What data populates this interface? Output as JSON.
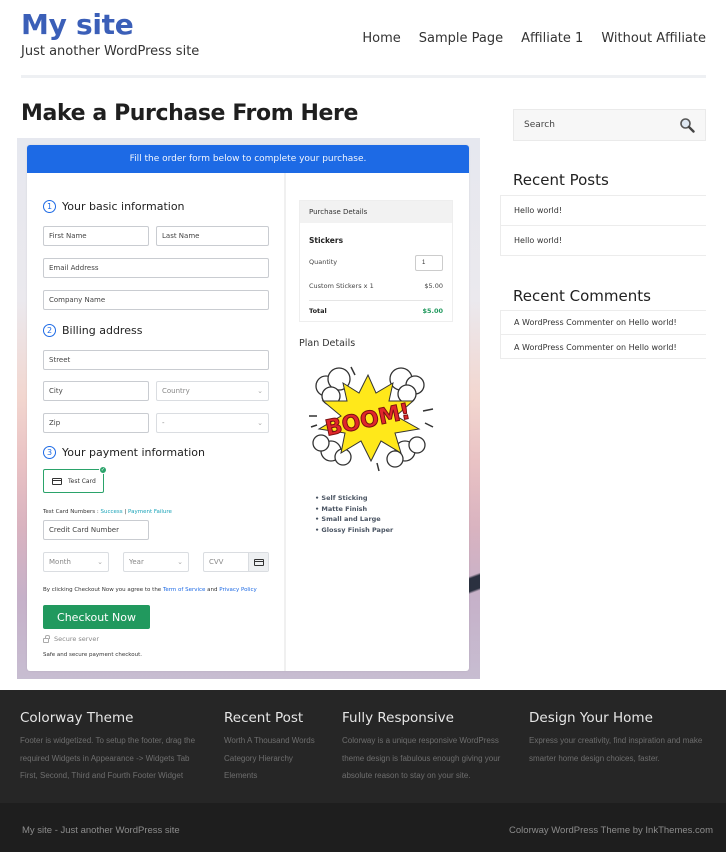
{
  "header": {
    "site_title": "My site",
    "tagline": "Just another WordPress site",
    "nav": [
      {
        "label": "Home"
      },
      {
        "label": "Sample Page"
      },
      {
        "label": "Affiliate 1"
      },
      {
        "label": "Without Affiliate"
      }
    ]
  },
  "main": {
    "page_title": "Make a Purchase From Here",
    "order_form": {
      "banner": "Fill the order form below to complete your purchase.",
      "sections": [
        {
          "number": "1",
          "title": "Your basic information"
        },
        {
          "number": "2",
          "title": "Billing address"
        },
        {
          "number": "3",
          "title": "Your payment information"
        }
      ],
      "fields": {
        "first_name": "First Name",
        "last_name": "Last Name",
        "email": "Email Address",
        "company": "Company Name",
        "street": "Street",
        "city": "City",
        "country": "Country",
        "zip": "Zip",
        "state": "-",
        "card_number": "Credit Card Number",
        "month": "Month",
        "year": "Year",
        "cvv": "CVV"
      },
      "payment_method": "Test Card",
      "test_card_label": "Test Card Numbers :",
      "test_success": "Success",
      "test_separator": "|",
      "test_failure": "Payment Failure",
      "terms_prefix": "By clicking Checkout Now you agree to the",
      "terms_link": "Term of Service",
      "terms_and": "and",
      "privacy_link": "Privacy Policy",
      "checkout_button": "Checkout Now",
      "secure_server": "Secure server",
      "safe_text": "Safe and secure payment checkout.",
      "purchase_details": {
        "title": "Purchase Details",
        "product": "Stickers",
        "quantity_label": "Quantity",
        "quantity_value": "1",
        "line_item": "Custom Stickers x 1",
        "line_price": "$5.00",
        "total_label": "Total",
        "total_value": "$5.00"
      },
      "plan_details": {
        "title": "Plan Details",
        "image_alt": "BOOM!",
        "features": [
          "Self Sticking",
          "Matte Finish",
          "Small and Large",
          "Glossy Finish Paper"
        ]
      }
    }
  },
  "sidebar": {
    "search_placeholder": "Search",
    "recent_posts_title": "Recent Posts",
    "recent_posts": [
      "Hello world!",
      "Hello world!"
    ],
    "recent_comments_title": "Recent Comments",
    "recent_comments": [
      {
        "author": "A WordPress Commenter",
        "on": "on",
        "post": "Hello world!"
      },
      {
        "author": "A WordPress Commenter",
        "on": "on",
        "post": "Hello world!"
      }
    ]
  },
  "footer": {
    "columns": [
      {
        "title": "Colorway Theme",
        "lines": [
          "Footer is widgetized. To setup the footer, drag the",
          "required Widgets in Appearance -> Widgets Tab",
          "First, Second, Third and Fourth Footer Widget"
        ]
      },
      {
        "title": "Recent Post",
        "lines": [
          "Worth A Thousand Words",
          "Category Hierarchy",
          "Elements"
        ]
      },
      {
        "title": "Fully Responsive",
        "lines": [
          "Colorway is a unique responsive WordPress",
          "theme design is fabulous enough giving your",
          "absolute reason to stay on your site."
        ]
      },
      {
        "title": "Design Your Home",
        "lines": [
          "Express your creativity, find inspiration and make",
          "smarter home design choices, faster."
        ]
      }
    ],
    "bottom_left": "My site - Just another WordPress site",
    "bottom_right": "Colorway WordPress Theme by InkThemes.com"
  },
  "colors": {
    "brand_blue": "#3b5fb8",
    "banner_blue": "#1d6ae5",
    "checkout_green": "#21995e",
    "total_green": "#21995e",
    "footer_bg": "#262626"
  }
}
